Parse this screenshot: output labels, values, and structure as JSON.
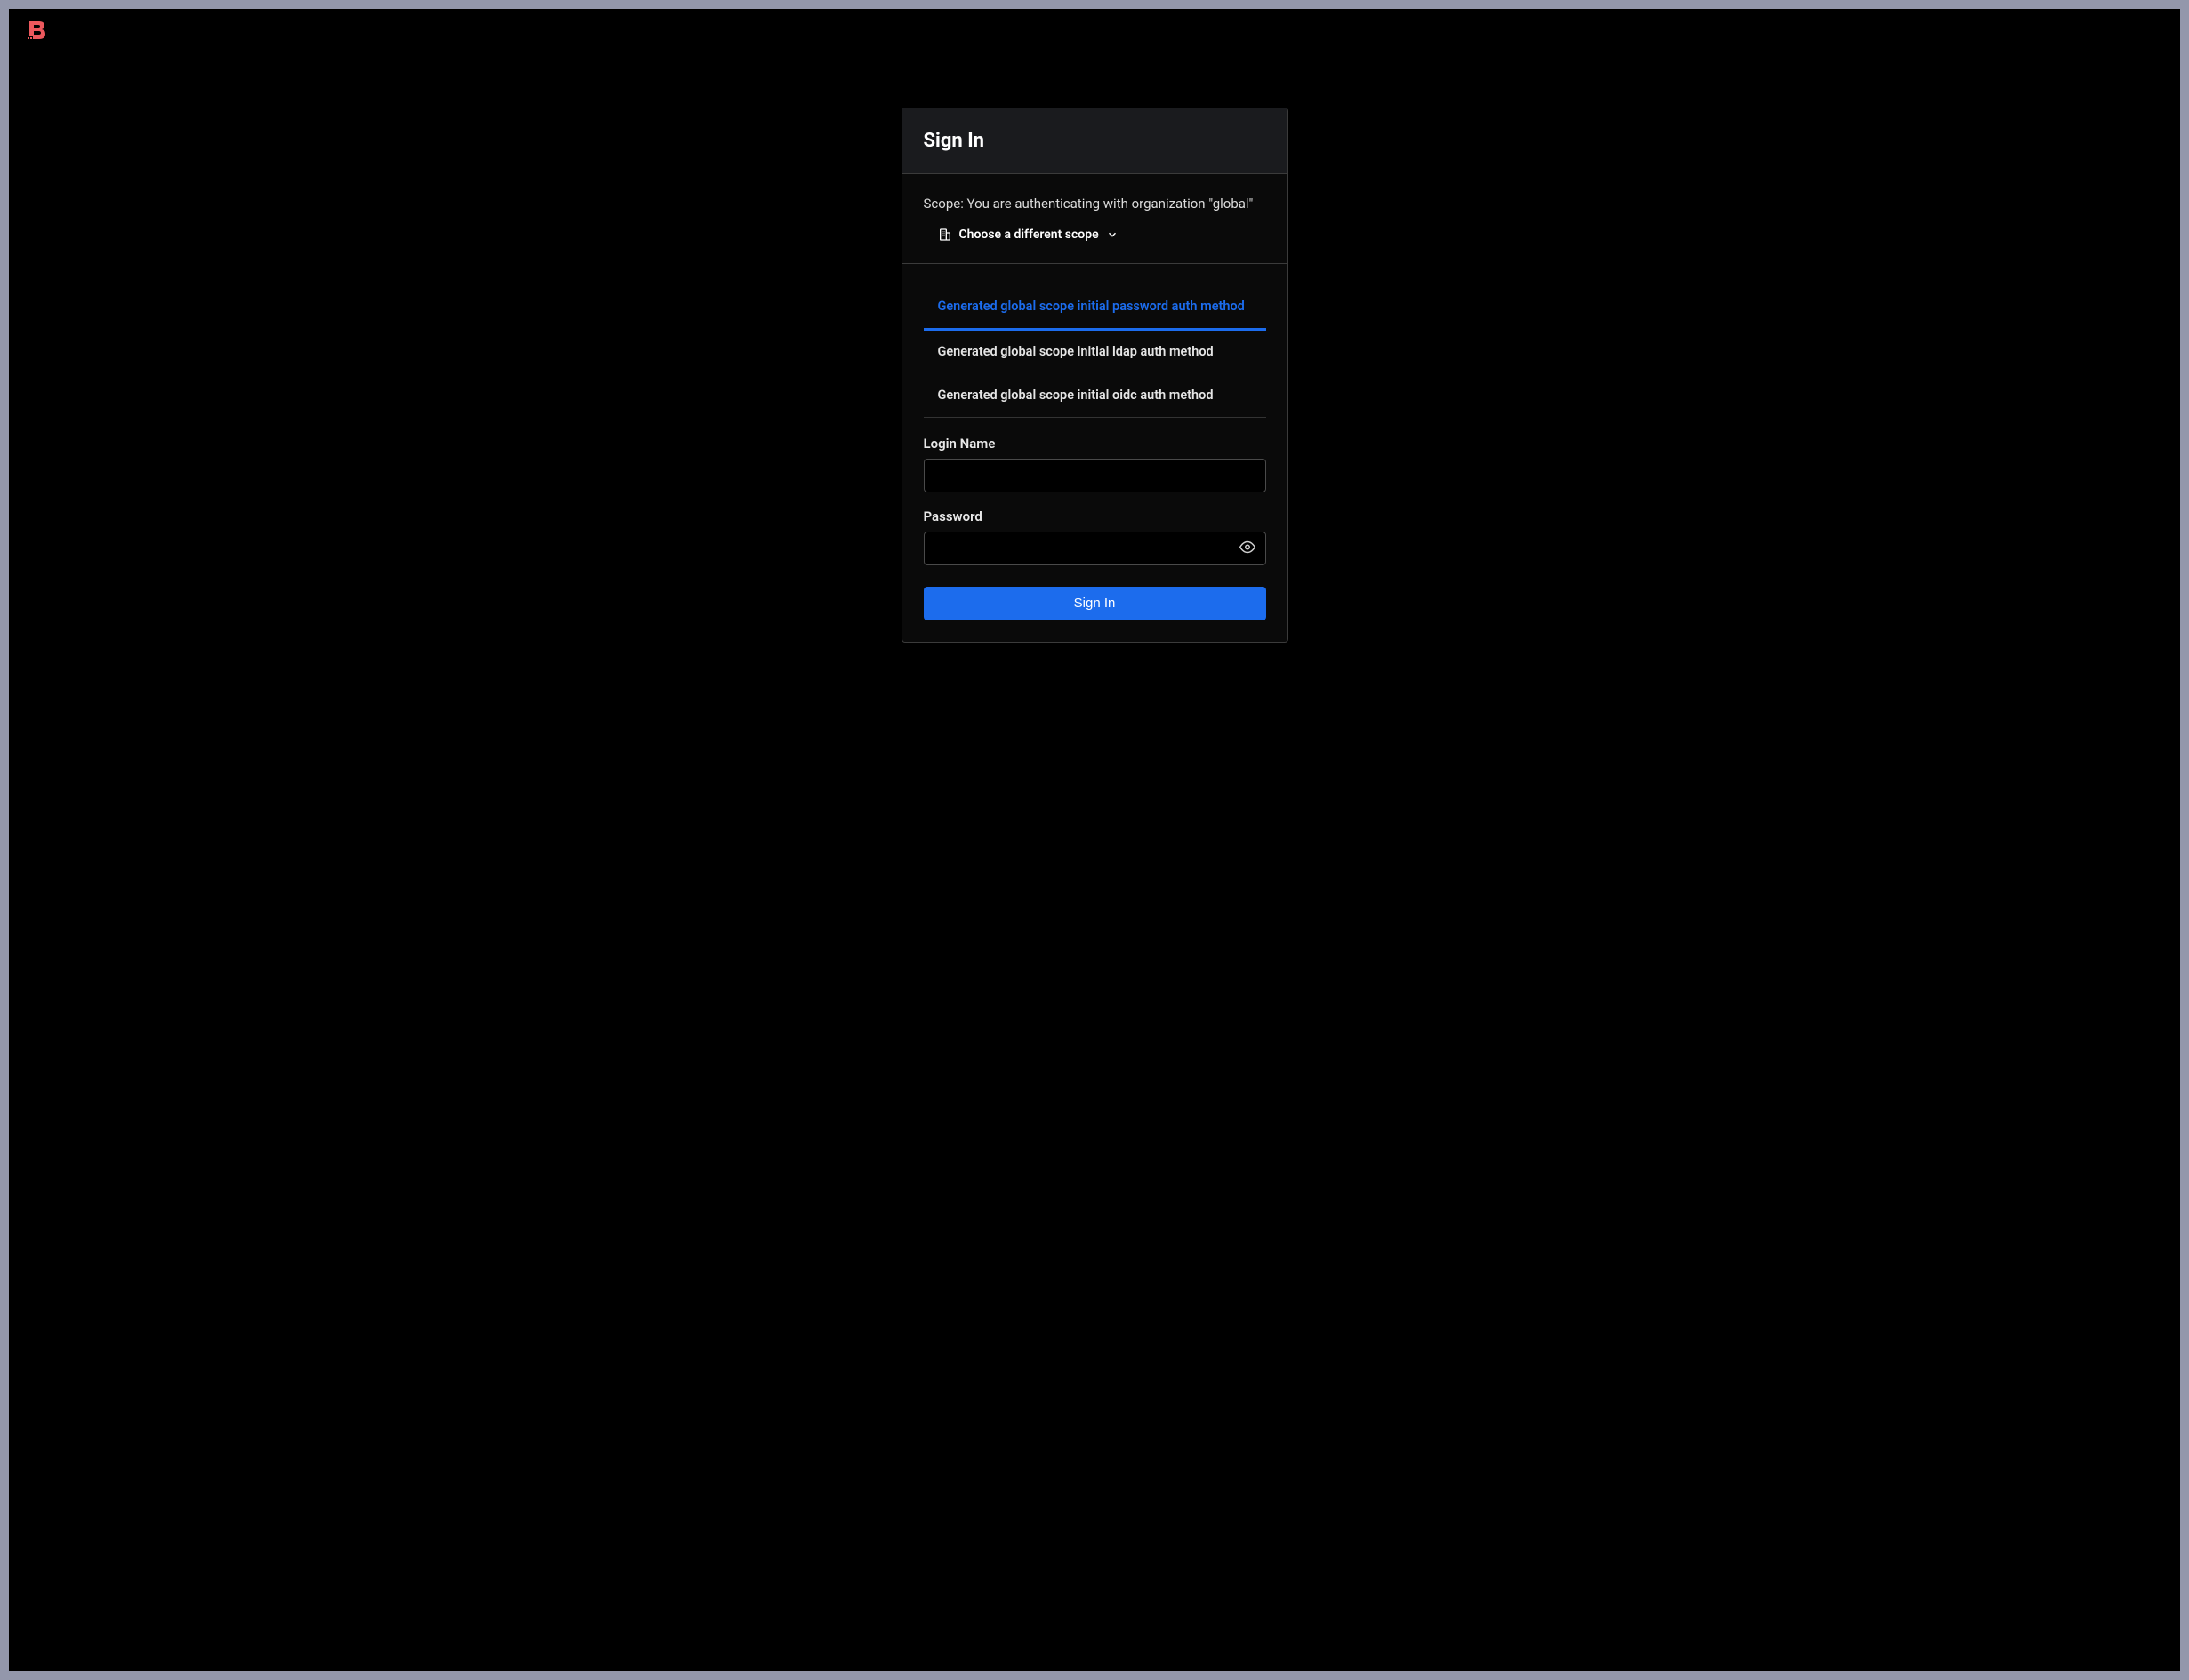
{
  "card": {
    "title": "Sign In"
  },
  "scope": {
    "text": "Scope: You are authenticating with organization \"global\"",
    "button_label": "Choose a different scope"
  },
  "tabs": [
    {
      "label": "Generated global scope initial password auth method",
      "active": true
    },
    {
      "label": "Generated global scope initial ldap auth method",
      "active": false
    },
    {
      "label": "Generated global scope initial oidc auth method",
      "active": false
    }
  ],
  "form": {
    "login_label": "Login Name",
    "login_value": "",
    "password_label": "Password",
    "password_value": "",
    "submit_label": "Sign In"
  },
  "colors": {
    "accent": "#1c6ced",
    "brand": "#ec585d"
  }
}
